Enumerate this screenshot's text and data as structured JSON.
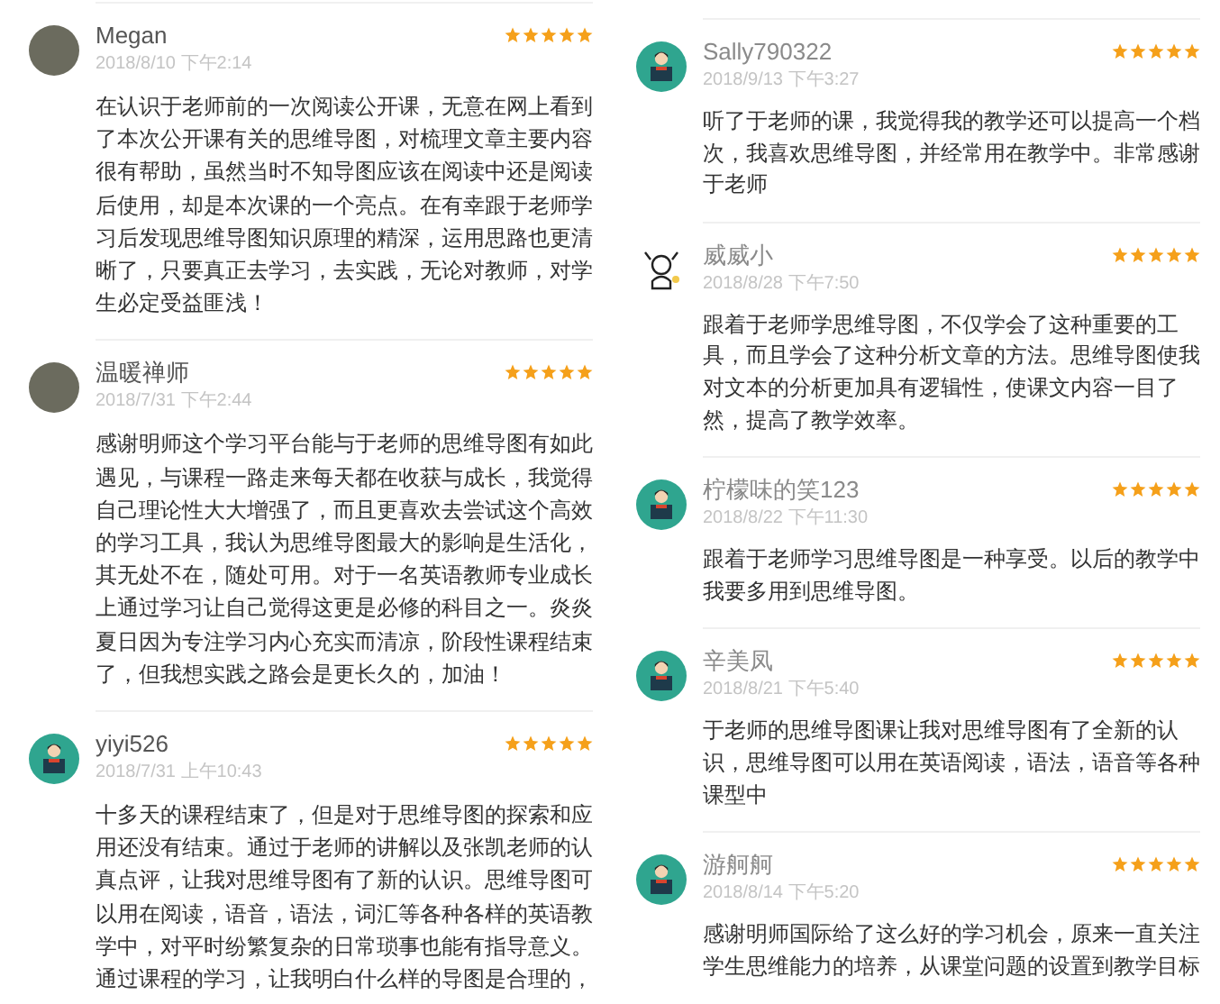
{
  "left_panel": {
    "reviews": [
      {
        "kind": "photo",
        "name": "Megan",
        "date": "2018/8/10 下午2:14",
        "stars": 5,
        "text": "在认识于老师前的一次阅读公开课，无意在网上看到了本次公开课有关的思维导图，对梳理文章主要内容很有帮助，虽然当时不知导图应该在阅读中还是阅读后使用，却是本次课的一个亮点。在有幸跟于老师学习后发现思维导图知识原理的精深，运用思路也更清晰了，只要真正去学习，去实践，无论对教师，对学生必定受益匪浅！"
      },
      {
        "kind": "photo",
        "name": "温暖禅师",
        "date": "2018/7/31 下午2:44",
        "stars": 5,
        "text": "感谢明师这个学习平台能与于老师的思维导图有如此遇见，与课程一路走来每天都在收获与成长，我觉得自己理论性大大增强了，而且更喜欢去尝试这个高效的学习工具，我认为思维导图最大的影响是生活化，其无处不在，随处可用。对于一名英语教师专业成长上通过学习让自己觉得这更是必修的科目之一。炎炎夏日因为专注学习内心充实而清凉，阶段性课程结束了，但我想实践之路会是更长久的，加油！"
      },
      {
        "kind": "cartoon",
        "name": "yiyi526",
        "date": "2018/7/31 上午10:43",
        "stars": 5,
        "text": "十多天的课程结束了，但是对于思维导图的探索和应用还没有结束。通过于老师的讲解以及张凯老师的认真点评，让我对思维导图有了新的认识。思维导图可以用在阅读，语音，语法，词汇等各种各样的英语教学中，对平时纷繁复杂的日常琐事也能有指导意义。通过课程的学习，让我明白什么样的导图是合理的，"
      }
    ]
  },
  "right_panel": {
    "reviews": [
      {
        "kind": "cartoon",
        "name": "Sally790322",
        "date": "2018/9/13 下午3:27",
        "stars": 5,
        "text": "听了于老师的课，我觉得我的教学还可以提高一个档次，我喜欢思维导图，并经常用在教学中。非常感谢于老师"
      },
      {
        "kind": "drawing",
        "name": "威威小",
        "date": "2018/8/28 下午7:50",
        "stars": 5,
        "text": "跟着于老师学思维导图，不仅学会了这种重要的工具，而且学会了这种分析文章的方法。思维导图使我对文本的分析更加具有逻辑性，使课文内容一目了然，提高了教学效率。"
      },
      {
        "kind": "cartoon",
        "name": "柠檬味的笑123",
        "date": "2018/8/22 下午11:30",
        "stars": 5,
        "text": "跟着于老师学习思维导图是一种享受。以后的教学中我要多用到思维导图。"
      },
      {
        "kind": "cartoon",
        "name": "辛美凤",
        "date": "2018/8/21 下午5:40",
        "stars": 5,
        "text": "于老师的思维导图课让我对思维导图有了全新的认识，思维导图可以用在英语阅读，语法，语音等各种课型中"
      },
      {
        "kind": "cartoon",
        "name": "游舸舸",
        "date": "2018/8/14 下午5:20",
        "stars": 5,
        "text": "感谢明师国际给了这么好的学习机会，原来一直关注学生思维能力的培养，从课堂问题的设置到教学目标"
      }
    ]
  }
}
